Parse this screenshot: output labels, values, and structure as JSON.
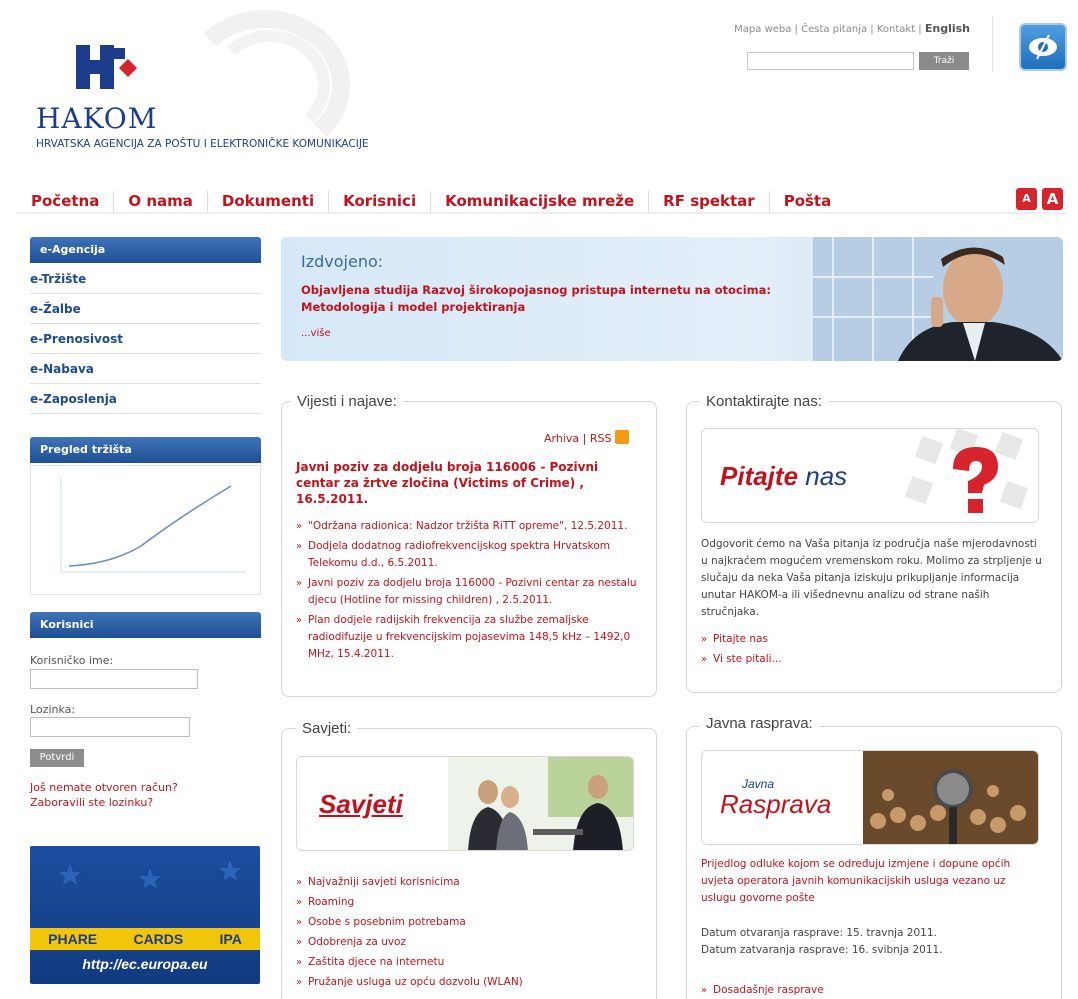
{
  "header": {
    "logo_text": "HAKOM",
    "logo_subtitle": "HRVATSKA AGENCIJA ZA POŠTU I ELEKTRONIČKE KOMUNIKACIJE",
    "top_links": [
      "Mapa weba",
      "Česta pitanja",
      "Kontakt",
      "English"
    ],
    "search_button": "Traži",
    "search_value": ""
  },
  "nav": {
    "items": [
      "Početna",
      "O nama",
      "Dokumenti",
      "Korisnici",
      "Komunikacijske mreže",
      "RF spektar",
      "Pošta"
    ],
    "font_small": "A",
    "font_large": "A"
  },
  "sidebar": {
    "eagency_title": "e-Agencija",
    "eagency_items": [
      "e-Tržište",
      "e-Žalbe",
      "e-Prenosivost",
      "e-Nabava",
      "e-Zaposlenja"
    ],
    "market_title": "Pregled tržišta",
    "users_title": "Korisnici",
    "username_label": "Korisničko ime:",
    "password_label": "Lozinka:",
    "submit_label": "Potvrdi",
    "register_link": "Još nemate otvoren račun?",
    "forgot_link": "Zaboravili ste lozinku?",
    "eu_programs": [
      "PHARE",
      "CARDS",
      "IPA"
    ],
    "eu_url": "http://ec.europa.eu"
  },
  "featured": {
    "title": "Izdvojeno:",
    "text": "Objavljena studija Razvoj širokopojasnog pristupa internetu na otocima: Metodologija i model projektiranja",
    "more": "...više"
  },
  "news": {
    "title": "Vijesti i najave:",
    "archive": "Arhiva",
    "rss": "RSS",
    "headline": "Javni poziv za dodjelu broja 116006 - Pozivni centar za žrtve zločina (Victims of Crime) , 16.5.2011.",
    "items": [
      "\"Održana radionica: Nadzor tržišta RiTT opreme\", 12.5.2011.",
      "Dodjela dodatnog radiofrekvencijskog spektra Hrvatskom Telekomu d.d., 6.5.2011.",
      "Javni poziv za dodjelu broja 116000 - Pozivni centar za nestalu djecu (Hotline for missing children) , 2.5.2011.",
      "Plan dodjele radijskih frekvencija za službe zemaljske radiodifuzije u frekvencijskim pojasevima 148,5 kHz – 1492,0 MHz, 15.4.2011."
    ]
  },
  "contact": {
    "title": "Kontaktirajte nas:",
    "panel_word_1": "Pitajte",
    "panel_word_2": "nas",
    "text": "Odgovorit ćemo na Vaša pitanja iz područja naše mjerodavnosti u najkraćem mogućem vremenskom roku. Molimo za strpljenje u slučaju da neka Vaša pitanja iziskuju prikupljanje informacija unutar HAKOM-a ili višednevnu analizu od strane naših stručnjaka.",
    "links": [
      "Pitajte nas",
      "Vi ste pitali..."
    ]
  },
  "tips": {
    "title": "Savjeti:",
    "panel_word": "Savjeti",
    "items": [
      "Najvažniji savjeti korisnicima",
      "Roaming",
      "Osobe s posebnim potrebama",
      "Odobrenja za uvoz",
      "Zaštita djece na internetu",
      "Pružanje usluga uz opću dozvolu (WLAN)"
    ]
  },
  "debate": {
    "title": "Javna rasprava:",
    "panel_small": "Javna",
    "panel_word": "Rasprava",
    "text": "Prijedlog odluke kojom se određuju izmjene i dopune općih uvjeta operatora javnih komunikacijskih usluga vezano uz uslugu govorne pošte",
    "open_label": "Datum otvaranja rasprave:",
    "open_date": "15. travnja 2011.",
    "close_label": "Datum zatvaranja rasprave:",
    "close_date": "16. svibnja 2011.",
    "link": "Dosadašnje rasprave"
  },
  "colors": {
    "brand_red": "#c4121c",
    "brand_blue": "#1d4b8f"
  }
}
